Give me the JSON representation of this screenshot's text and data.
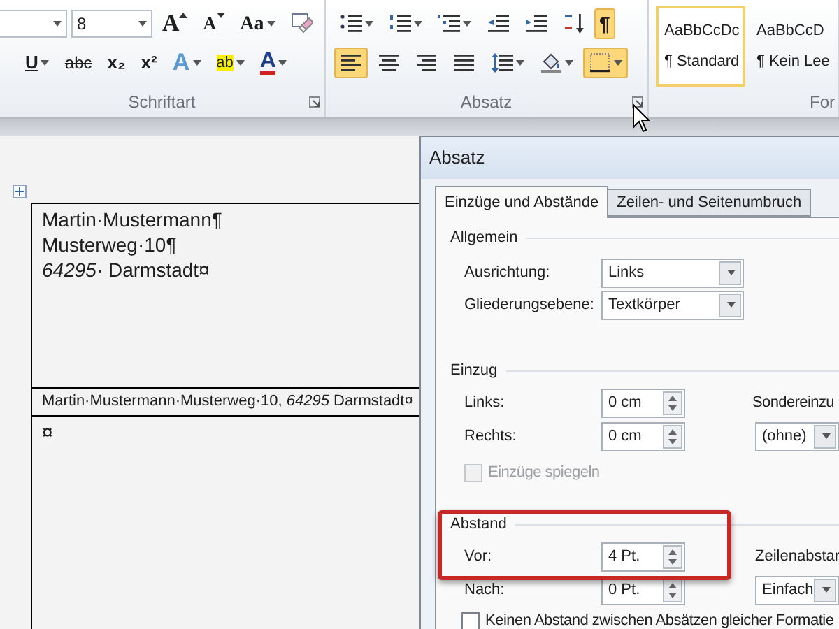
{
  "ribbon": {
    "groups": [
      {
        "label": "Schriftart",
        "launcher": true,
        "font_size": "8",
        "row1": [
          {
            "kind": "grow_font",
            "label": "A",
            "dropdown": false,
            "selected": false
          },
          {
            "kind": "shrink_font",
            "label": "A",
            "dropdown": false,
            "selected": false
          },
          {
            "kind": "change_case",
            "label": "Aa",
            "dropdown": true,
            "selected": false
          },
          {
            "kind": "clear_format",
            "dropdown": false,
            "selected": false
          }
        ],
        "row2": [
          {
            "kind": "underline",
            "label": "U",
            "dropdown": true,
            "selected": false
          },
          {
            "kind": "strike",
            "label": "abc",
            "dropdown": false,
            "selected": false
          },
          {
            "kind": "subscript",
            "label": "x₂",
            "dropdown": false,
            "selected": false
          },
          {
            "kind": "superscript",
            "label": "x²",
            "dropdown": false,
            "selected": false
          },
          {
            "kind": "text_effects",
            "label": "A",
            "dropdown": true,
            "selected": false
          },
          {
            "kind": "highlight",
            "label": "ab",
            "dropdown": true,
            "selected": false
          },
          {
            "kind": "font_color",
            "label": "A",
            "dropdown": true,
            "selected": false
          }
        ]
      },
      {
        "label": "Absatz",
        "launcher": true,
        "row1": [
          {
            "kind": "bullets",
            "dropdown": true,
            "selected": false
          },
          {
            "kind": "numbering",
            "dropdown": true,
            "selected": false
          },
          {
            "kind": "multilevel",
            "dropdown": true,
            "selected": false
          },
          {
            "kind": "outdent",
            "dropdown": false,
            "selected": false
          },
          {
            "kind": "indent",
            "dropdown": false,
            "selected": false
          },
          {
            "kind": "sort",
            "dropdown": false,
            "selected": false
          },
          {
            "kind": "show_marks",
            "label": "¶",
            "dropdown": false,
            "selected": true
          }
        ],
        "row2": [
          {
            "kind": "align_left",
            "dropdown": false,
            "selected": true
          },
          {
            "kind": "align_center",
            "dropdown": false,
            "selected": false
          },
          {
            "kind": "align_right",
            "dropdown": false,
            "selected": false
          },
          {
            "kind": "justify",
            "dropdown": false,
            "selected": false
          },
          {
            "kind": "line_spacing",
            "dropdown": true,
            "selected": false
          },
          {
            "kind": "shading",
            "dropdown": true,
            "selected": false
          },
          {
            "kind": "borders",
            "dropdown": true,
            "selected": true
          }
        ]
      },
      {
        "label": "For",
        "launcher": false,
        "styles": [
          {
            "preview": "AaBbCcDc",
            "name": "¶ Standard",
            "selected": true
          },
          {
            "preview": "AaBbCcD",
            "name": "¶ Kein Lee",
            "selected": false
          }
        ]
      }
    ]
  },
  "document": {
    "table": {
      "rows": [
        {
          "lines": [
            "Martin·Mustermann¶",
            "Musterweg·10¶",
            "*64295*· Darmstadt¤"
          ]
        },
        {
          "lines": [
            "Martin·Mustermann·Musterweg·10, *64295* Darmstadt¤"
          ]
        },
        {
          "lines": [
            "¤"
          ]
        }
      ]
    }
  },
  "dialog": {
    "title": "Absatz",
    "tabs": [
      {
        "label": "Einzüge und Abstände",
        "selected": true
      },
      {
        "label": "Zeilen- und Seitenumbruch",
        "selected": false
      }
    ],
    "general": {
      "heading": "Allgemein",
      "fields": [
        {
          "label": "Ausrichtung:",
          "value": "Links"
        },
        {
          "label": "Gliederungsebene:",
          "value": "Textkörper"
        }
      ]
    },
    "indent": {
      "heading": "Einzug",
      "left": {
        "label": "Links:",
        "value": "0 cm"
      },
      "right": {
        "label": "Rechts:",
        "value": "0 cm"
      },
      "special_label": "Sondereinzu",
      "special_value": "(ohne)",
      "mirror": {
        "label": "Einzüge spiegeln",
        "checked": false,
        "disabled": true
      }
    },
    "spacing": {
      "heading": "Abstand",
      "before": {
        "label": "Vor:",
        "value": "4 Pt."
      },
      "after": {
        "label": "Nach:",
        "value": "0 Pt."
      },
      "line_label": "Zeilenabstar",
      "line_value": "Einfach",
      "no_space": {
        "label": "Keinen Abstand zwischen Absätzen gleicher Formatie",
        "checked": false,
        "disabled": false
      }
    }
  }
}
